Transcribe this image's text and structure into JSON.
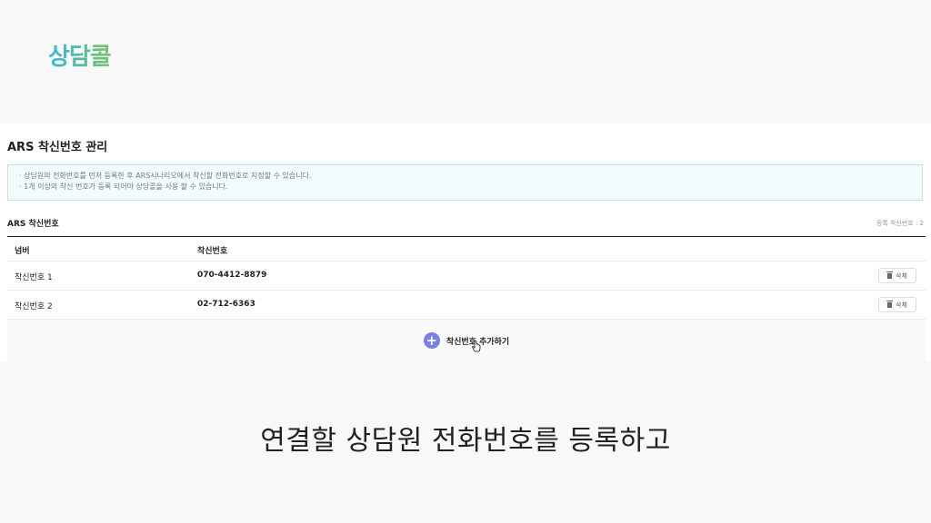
{
  "logo": {
    "text": "상담콜"
  },
  "page": {
    "title": "ARS 착신번호 관리"
  },
  "notice": {
    "lines": [
      "· 상담원의 전화번호를 먼저 등록한 후 ARS시나리오에서 착신할 전화번호로 지정할 수 있습니다.",
      "· 1개 이상의 착신 번호가 등록 되어야 상담콜을 사용 할 수 있습니다."
    ]
  },
  "section": {
    "title": "ARS 착신번호",
    "count": "등록 착신번호 : 2"
  },
  "table": {
    "headers": [
      "넘버",
      "착신번호"
    ],
    "rows": [
      {
        "label": "착신번호 1",
        "number": "070-4412-8879",
        "action": "삭제"
      },
      {
        "label": "착신번호 2",
        "number": "02-712-6363",
        "action": "삭제"
      }
    ]
  },
  "add_button": {
    "label": "착신번호 추가하기",
    "icon": "plus-icon"
  },
  "caption": "연결할 상담원 전화번호를 등록하고",
  "colors": {
    "accent": "#7b80e6",
    "notice_border": "#bfe3ea"
  }
}
